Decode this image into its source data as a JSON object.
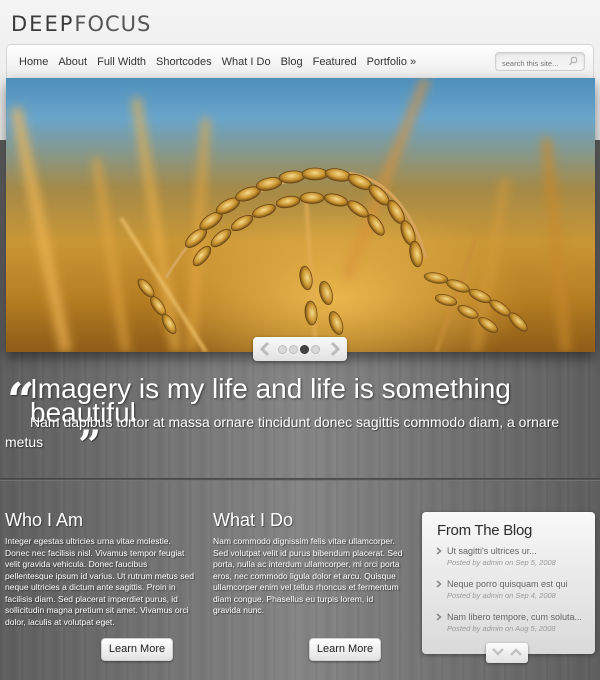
{
  "site": {
    "logo_bold": "DEEP",
    "logo_light": "FOCUS"
  },
  "nav": {
    "items": [
      {
        "label": "Home"
      },
      {
        "label": "About"
      },
      {
        "label": "Full Width"
      },
      {
        "label": "Shortcodes"
      },
      {
        "label": "What I Do"
      },
      {
        "label": "Blog"
      },
      {
        "label": "Featured"
      },
      {
        "label": "Portfolio »"
      }
    ],
    "search_placeholder": "search this site...",
    "search_value": ""
  },
  "slider": {
    "image": "wheat-field-photo",
    "dot_count": 4,
    "active_dot": 3,
    "prev_icon": "chevron-left-icon",
    "next_icon": "chevron-right-icon"
  },
  "quote": {
    "open_mark": "“",
    "headline": "Imagery is my life and life is something beautiful",
    "body": "Nam dapibus tortor at massa ornare tincidunt donec sagittis commodo diam, a ornare metus",
    "close_mark": "”"
  },
  "columns": [
    {
      "title": "Who I Am",
      "text": "Integer egestas ultricies urna vitae molestie. Donec nec facilisis nisl. Vivamus tempor feugiat velit gravida vehicula. Donec faucibus pellentesque ipsum id varius. Ut rutrum metus sed neque ultricies a dictum ante sagittis. Proin in facilisis diam. Sed placerat imperdiet purus, id sollicitudin magna pretium sit amet. Vivamus orci dolor, iaculis at volutpat eget.",
      "button": "Learn More"
    },
    {
      "title": "What I Do",
      "text": "Nam commodo dignissim felis vitae ullamcorper. Sed volutpat velit id purus bibendum placerat. Sed porta, nulla ac interdum ullamcorper, mi orci porta eros, nec commodo ligula dolor et arcu. Quisque ullamcorper enim vel tellus rhoncus et fermentum diam congue. Phasellus eu turpis lorem, id gravida nunc.",
      "button": "Learn More"
    }
  ],
  "blog": {
    "title": "From The Blog",
    "posts": [
      {
        "title": "Ut sagitti's ultrices ur...",
        "meta": "Posted by admin on Sep 5, 2008"
      },
      {
        "title": "Neque porro quisquam est qui",
        "meta": "Posted by admin on Sep 4, 2008"
      },
      {
        "title": "Nam libero tempore, cum soluta...",
        "meta": "Posted by admin on Aug 5, 2008"
      }
    ]
  }
}
